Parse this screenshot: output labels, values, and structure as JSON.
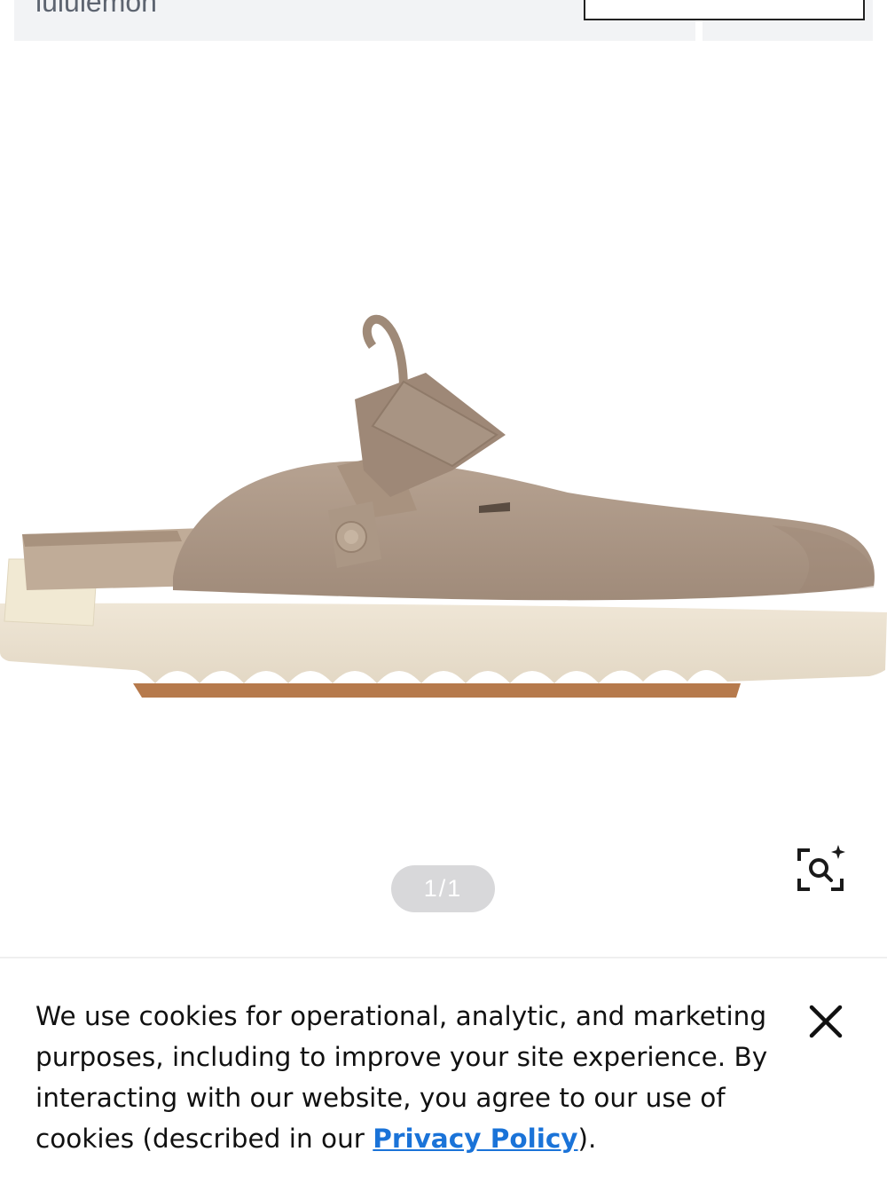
{
  "header": {
    "search_text": "lululemon"
  },
  "product": {
    "image_alt": "Taupe suede clog with strap and wavy cream sole",
    "image_counter": "1/1"
  },
  "icons": {
    "zoom": "zoom-search-sparkle-icon",
    "close": "close-icon"
  },
  "cookie_banner": {
    "message": "We use cookies for operational, analytic, and marketing purposes, including to improve your site experience. By interacting with our website, you agree to our use of cookies (described in our ",
    "link_text": "Privacy Policy",
    "after_link": ")."
  },
  "colors": {
    "link": "#1a73d8",
    "pill": "#d8d8da"
  }
}
